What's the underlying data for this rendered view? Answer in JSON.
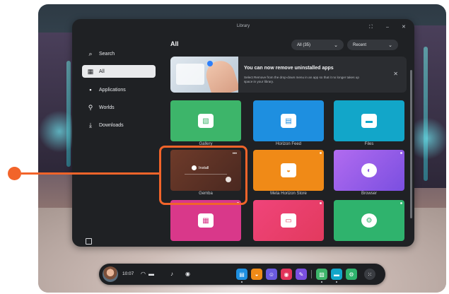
{
  "window": {
    "title": "Library",
    "controls": {
      "restore": "⛶",
      "minimize": "–",
      "close": "✕"
    }
  },
  "sidebar": {
    "items": [
      {
        "label": "Search",
        "icon": "search-icon",
        "glyph": "⌕"
      },
      {
        "label": "All",
        "icon": "grid-icon",
        "glyph": "▦",
        "selected": true
      },
      {
        "label": "Applications",
        "icon": "apps-icon",
        "glyph": "▪"
      },
      {
        "label": "Worlds",
        "icon": "worlds-icon",
        "glyph": "⚲"
      },
      {
        "label": "Downloads",
        "icon": "download-icon",
        "glyph": "⤓"
      }
    ]
  },
  "content": {
    "heading": "All",
    "filter_dropdown": {
      "value": "All (35)",
      "chevron": "⌄"
    },
    "sort_dropdown": {
      "value": "Recent",
      "chevron": "⌄"
    }
  },
  "banner": {
    "title": "You can now remove uninstalled apps",
    "text": "Select Remove from the drop-down menu in an app so that it no longer takes up space in your library.",
    "close": "✕"
  },
  "tiles": [
    {
      "label": "Gallery",
      "icon": "gallery-icon",
      "glyph": "▧",
      "color": "#3db56a"
    },
    {
      "label": "Horizon Feed",
      "icon": "feed-icon",
      "glyph": "▤",
      "color": "#1e8fe0"
    },
    {
      "label": "Files",
      "icon": "folder-icon",
      "glyph": "▬",
      "color": "#12a6c9"
    },
    {
      "label": "Gemba",
      "icon": "install-icon",
      "glyph": "",
      "color": "#6b3a2a",
      "overlay_label": "Install",
      "menu": "•••"
    },
    {
      "label": "Meta Horizon Store",
      "icon": "store-bag-icon",
      "glyph": "◒",
      "color": "#f08a17"
    },
    {
      "label": "Browser",
      "icon": "browser-icon",
      "glyph": "◐",
      "color": "#9a5be6"
    },
    {
      "label": "",
      "icon": "calendar-icon",
      "glyph": "▦",
      "color": "#d9388a"
    },
    {
      "label": "",
      "icon": "tv-icon",
      "glyph": "▭",
      "color": "#e23a5e"
    },
    {
      "label": "",
      "icon": "settings-icon",
      "glyph": "⚙",
      "color": "#2fb36d"
    }
  ],
  "taskbar": {
    "time": "10:07",
    "wifi": "◠",
    "battery": "▬",
    "mic": "♪",
    "controller": "◉",
    "apps": [
      {
        "name": "taskbar-app-feed",
        "color": "#1e8fe0",
        "glyph": "▤"
      },
      {
        "name": "taskbar-app-store",
        "color": "#f08a17",
        "glyph": "◒"
      },
      {
        "name": "taskbar-app-people",
        "color": "#6a5ae0",
        "glyph": "☺"
      },
      {
        "name": "taskbar-app-camera",
        "color": "#e2345a",
        "glyph": "◉"
      },
      {
        "name": "taskbar-app-chat",
        "color": "#7b4fe0",
        "glyph": "✎"
      },
      {
        "name": "taskbar-app-gallery",
        "color": "#3db56a",
        "glyph": "▧"
      },
      {
        "name": "taskbar-app-files",
        "color": "#12a6c9",
        "glyph": "▬"
      },
      {
        "name": "taskbar-app-settings",
        "color": "#2fb36d",
        "glyph": "⚙"
      },
      {
        "name": "taskbar-app-library",
        "color": "#3a3d42",
        "glyph": "⁙"
      }
    ]
  },
  "colors": {
    "annotation": "#f2642a",
    "window_bg": "#1f2124"
  }
}
